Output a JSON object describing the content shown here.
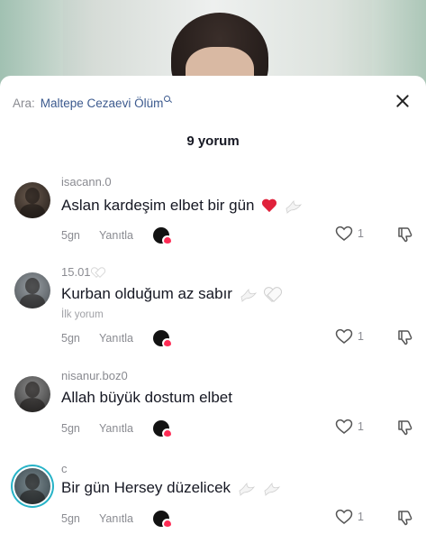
{
  "search": {
    "prefix": "Ara:",
    "term": "Maltepe Cezaevi Ölüm"
  },
  "header": {
    "comment_count": "9 yorum"
  },
  "comments": [
    {
      "username": "isacann.0",
      "text": "Aslan kardeşim elbet bir gün",
      "emojis": [
        "red-heart",
        "dove"
      ],
      "time": "5gn",
      "reply_label": "Yanıtla",
      "likes": "1"
    },
    {
      "username": "15.01",
      "username_emoji": "white-heart",
      "text": "Kurban olduğum az sabır",
      "emojis": [
        "dove",
        "white-heart"
      ],
      "first_comment_label": "İlk yorum",
      "time": "5gn",
      "reply_label": "Yanıtla",
      "likes": "1"
    },
    {
      "username": "nisanur.boz0",
      "text": "Allah büyük dostum elbet",
      "emojis": [],
      "time": "5gn",
      "reply_label": "Yanıtla",
      "likes": "1"
    },
    {
      "username": "c",
      "text": "Bir gün Hersey düzelicek",
      "emojis": [
        "dove",
        "dove"
      ],
      "time": "5gn",
      "reply_label": "Yanıtla",
      "likes": "1"
    }
  ],
  "colors": {
    "link_blue": "#3c5a8e",
    "muted_gray": "#8a8b91",
    "heart_red": "#e0223b",
    "creator_heart": "#fe2c55",
    "story_ring": "#27b3c7"
  }
}
